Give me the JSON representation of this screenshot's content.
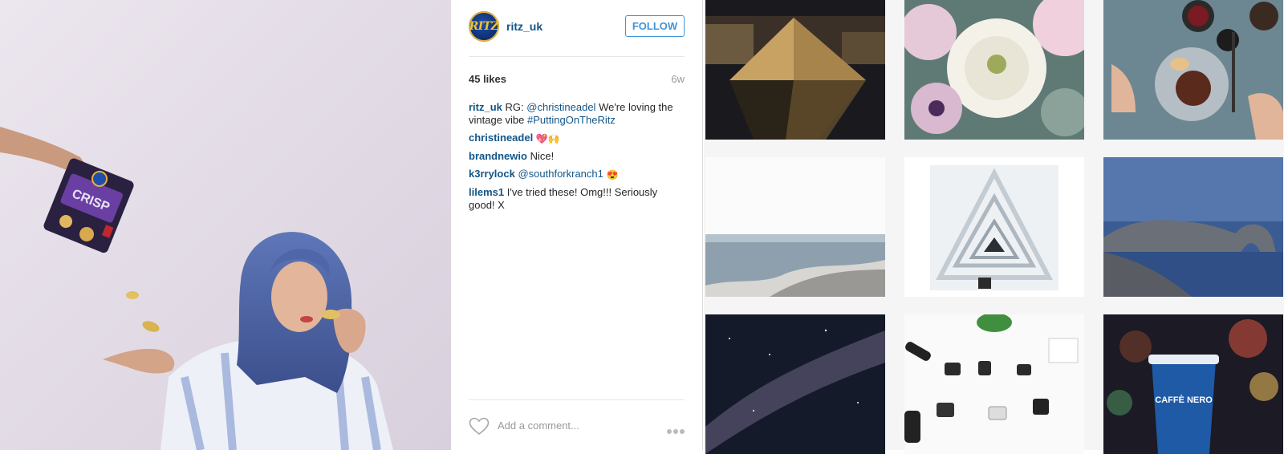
{
  "post": {
    "username": "ritz_uk",
    "avatar_text": "RITZ",
    "follow_label": "FOLLOW",
    "likes": "45 likes",
    "age": "6w",
    "comments": [
      {
        "user": "ritz_uk",
        "prefix": "RG: ",
        "mention": "@christineadel",
        "text": " We're loving the vintage vibe ",
        "hashtag": "#PuttingOnTheRitz"
      },
      {
        "user": "christineadel",
        "emoji": "💖🙌"
      },
      {
        "user": "brandnewio",
        "text": "Nice!"
      },
      {
        "user": "k3rrylock",
        "mention": "@southforkranch1",
        "emoji": "😍"
      },
      {
        "user": "lilems1",
        "text": "I've tried these! Omg!!! Seriously good! X"
      }
    ],
    "add_comment_placeholder": "Add a comment..."
  },
  "photo": {
    "bag_text": "CRISP",
    "bag_brand": "RITZ"
  },
  "grid": {
    "tiles": [
      {
        "name": "louvre-pyramid-night"
      },
      {
        "name": "white-flowers-bouquet"
      },
      {
        "name": "breakfast-table-flatlay"
      },
      {
        "name": "sea-horizon-rocks"
      },
      {
        "name": "white-spiral-staircase"
      },
      {
        "name": "durdle-door-coast"
      },
      {
        "name": "milky-way-night-sky"
      },
      {
        "name": "action-camera-accessories-flatlay"
      },
      {
        "name": "caffe-nero-cup-bokeh",
        "cup_text": "CAFFÈ NERO"
      }
    ]
  },
  "colors": {
    "link": "#125688",
    "follow": "#3f95d8"
  }
}
